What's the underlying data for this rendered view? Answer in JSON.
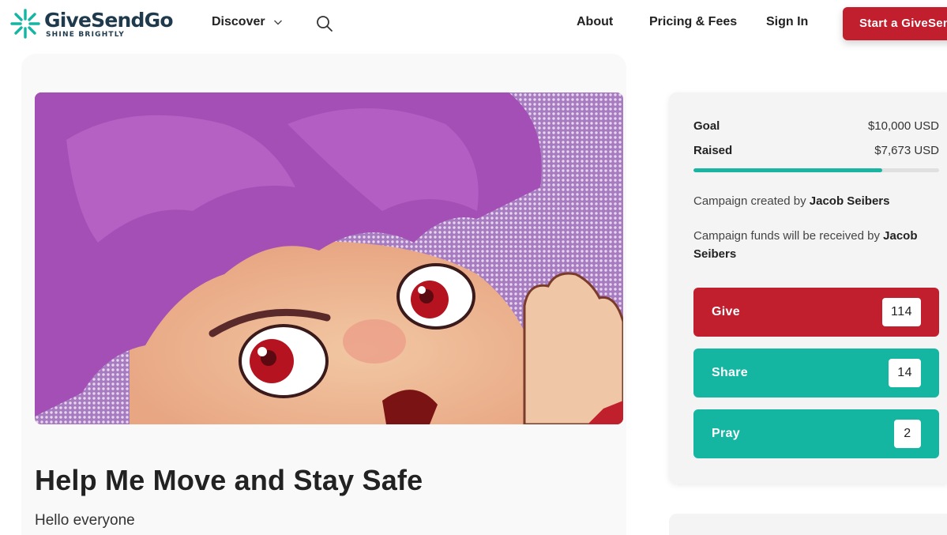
{
  "header": {
    "logo_name": "GiveSendGo",
    "logo_tagline": "SHINE BRIGHTLY",
    "discover": "Discover",
    "about": "About",
    "pricing": "Pricing & Fees",
    "signin": "Sign In",
    "start": "Start a GiveSendGo"
  },
  "campaign": {
    "title": "Help Me Move and Stay Safe",
    "intro": "Hello everyone"
  },
  "sidebar": {
    "goal_label": "Goal",
    "goal_value": "$10,000 USD",
    "raised_label": "Raised",
    "raised_value": "$7,673 USD",
    "progress_percent": 76.73,
    "created_prefix": "Campaign created by",
    "creator": "Jacob Seibers",
    "funds_prefix": "Campaign funds will be received by",
    "recipient": "Jacob Seibers",
    "give_label": "Give",
    "give_count": "114",
    "share_label": "Share",
    "share_count": "14",
    "pray_label": "Pray",
    "pray_count": "2"
  },
  "colors": {
    "brand_red": "#c21f2e",
    "brand_teal": "#14b6a2",
    "logo_navy": "#1e3a4c"
  },
  "icons": [
    "givesendgo-logo-icon",
    "chevron-down-icon",
    "search-icon"
  ]
}
